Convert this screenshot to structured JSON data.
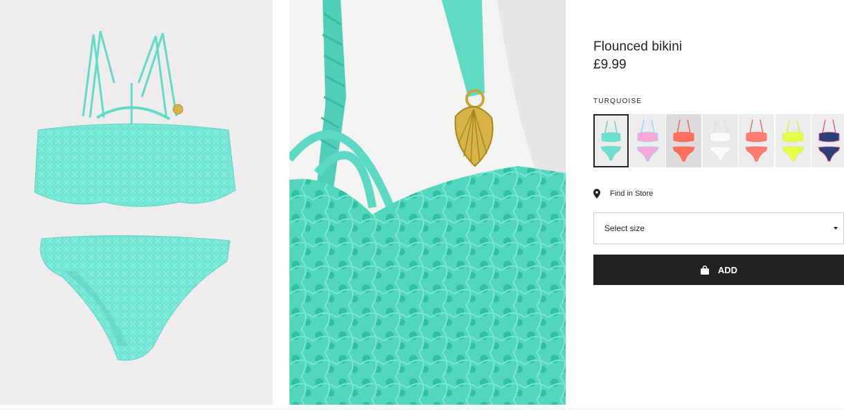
{
  "product": {
    "title": "Flounced bikini",
    "price": "£9.99",
    "color_label": "TURQUOISE",
    "selected_swatch": 0,
    "swatches": [
      {
        "name": "turquoise",
        "color": "#6fe0cd",
        "accent": "#5fd3c0",
        "bg": "#ececec"
      },
      {
        "name": "rainbow",
        "color": "#f7a8d6",
        "accent": "#8fd6f2",
        "bg": "#ececec"
      },
      {
        "name": "coral",
        "color": "#ff6f5e",
        "accent": "#ff5b4b",
        "bg": "#dcdcdc"
      },
      {
        "name": "white",
        "color": "#fafafa",
        "accent": "#dddddd",
        "bg": "#e9e9e9"
      },
      {
        "name": "coral-print",
        "color": "#ff7c70",
        "accent": "#e96c62",
        "bg": "#ececec"
      },
      {
        "name": "neon-yellow",
        "color": "#e8ff4a",
        "accent": "#d6f236",
        "bg": "#ececec"
      },
      {
        "name": "navy-print",
        "color": "#2e3f78",
        "accent": "#e65a9a",
        "bg": "#ececec"
      }
    ]
  },
  "store": {
    "label": "Find in Store",
    "icon": "location-pin-icon"
  },
  "size": {
    "placeholder": "Select size",
    "icon": "caret-down-icon"
  },
  "add": {
    "label": "ADD",
    "icon": "shopping-bag-icon"
  },
  "colors": {
    "primary": "#222222",
    "turquoise": "#6fe0cd",
    "border": "#cfcfcf"
  }
}
